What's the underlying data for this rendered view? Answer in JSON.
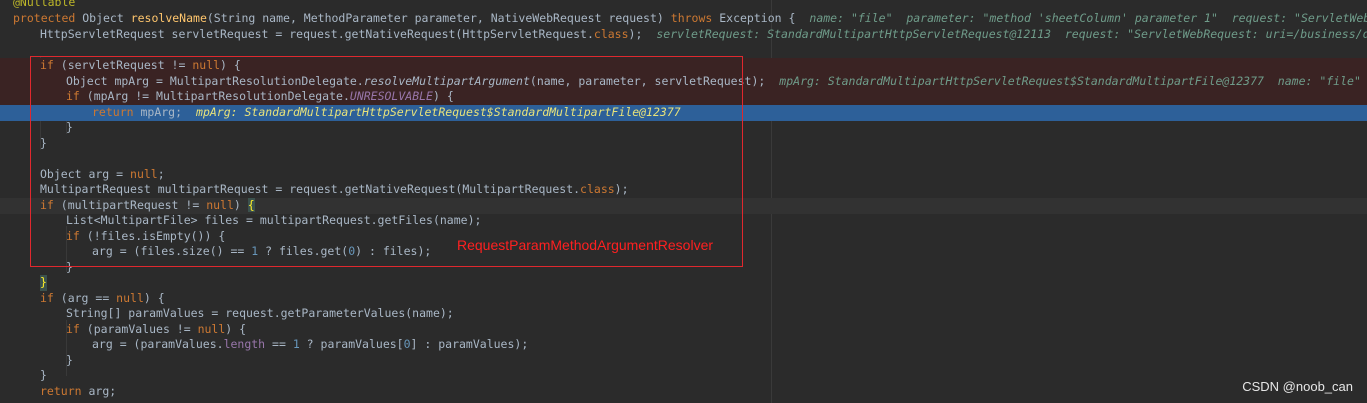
{
  "editor": {
    "annotation": "@Nullable",
    "method_sig": {
      "mod": "protected",
      "ret": " Object ",
      "name": "resolveName",
      "params": "(String name, MethodParameter parameter, NativeWebRequest request) ",
      "throws": "throws",
      "exc": " Exception {",
      "hint": "name: \"file\"  parameter: \"method 'sheetColumn' parameter 1\"  request: \"ServletWebRequest: uri"
    },
    "line_servlet": {
      "code": "HttpServletRequest servletRequest = request.getNativeRequest(HttpServletRequest.",
      "cls": "class",
      "end": ");",
      "hint": "servletRequest: StandardMultipartHttpServletRequest@12113  request: \"ServletWebRequest: uri=/business/dataCheck/she"
    },
    "line_if_servlet": {
      "kw": "if",
      "rest": " (servletRequest != ",
      "nul": "null",
      "end": ") {"
    },
    "line_mparg": {
      "pre": "Object mpArg = MultipartResolutionDelegate.",
      "call": "resolveMultipartArgument",
      "post": "(name, parameter, servletRequest);",
      "hint": "mpArg: StandardMultipartHttpServletRequest$StandardMultipartFile@12377  name: \"file\"  parameter: "
    },
    "line_if_unres": {
      "kw": "if",
      "pre": " (mpArg != MultipartResolutionDelegate.",
      "const": "UNRESOLVABLE",
      "end": ") {"
    },
    "line_return_mparg": {
      "kw": "return",
      "rest": " mpArg;",
      "hint": "mpArg: StandardMultipartHttpServletRequest$StandardMultipartFile@12377"
    },
    "brace_close": "}",
    "line_arg": {
      "pre": "Object arg = ",
      "nul": "null",
      "end": ";"
    },
    "line_multipart": {
      "code": "MultipartRequest multipartRequest = request.getNativeRequest(MultipartRequest.",
      "cls": "class",
      "end": ");"
    },
    "line_if_multipart": {
      "kw": "if",
      "rest": " (multipartRequest != ",
      "nul": "null",
      "end": ") ",
      "brace": "{"
    },
    "line_files": {
      "code": "List<MultipartFile> files = multipartRequest.getFiles(name);"
    },
    "line_if_empty": {
      "kw": "if",
      "rest": " (!files.isEmpty()) {"
    },
    "line_arg_files": {
      "pre": "arg = (files.size() == ",
      "n1": "1",
      "mid": " ? files.get(",
      "n0": "0",
      "end": ") : files);"
    },
    "brace_close_match": "}",
    "line_if_null": {
      "kw": "if",
      "rest": " (arg == ",
      "nul": "null",
      "end": ") {"
    },
    "line_paramvalues": {
      "code": "String[] paramValues = request.getParameterValues(name);"
    },
    "line_if_pv": {
      "kw": "if",
      "rest": " (paramValues != ",
      "nul": "null",
      "end": ") {"
    },
    "line_arg_pv": {
      "pre": "arg = (paramValues.",
      "field": "length",
      "mid": " == ",
      "n1": "1",
      "mid2": " ? paramValues[",
      "n0": "0",
      "end": "] : paramValues);"
    },
    "line_return_arg": {
      "kw": "return",
      "rest": " arg;"
    }
  },
  "overlay": {
    "box_label": "RequestParamMethodArgumentResolver",
    "watermark": "CSDN @noob_can"
  },
  "colors": {
    "background": "#2b2b2b",
    "keyword": "#cc7832",
    "exec_line": "#2d6099",
    "annotation_box": "#e0282e"
  }
}
